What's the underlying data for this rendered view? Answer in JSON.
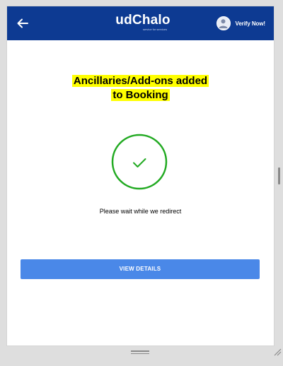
{
  "header": {
    "back_icon": "arrow-left-icon",
    "logo_title": "udChalo",
    "logo_tagline": "service for services",
    "verify_label": "Verify Now!",
    "avatar_icon": "user-avatar-icon",
    "background_color": "#0d3a92"
  },
  "main": {
    "headline_line1": "Ancillaries/Add-ons added",
    "headline_line2": "to Booking",
    "highlight_color": "#ffff00",
    "status_icon": "check-circle-icon",
    "status_color": "#22aa22",
    "wait_message": "Please wait while we redirect",
    "view_details_label": "VIEW DETAILS",
    "button_color": "#4a88e8"
  }
}
